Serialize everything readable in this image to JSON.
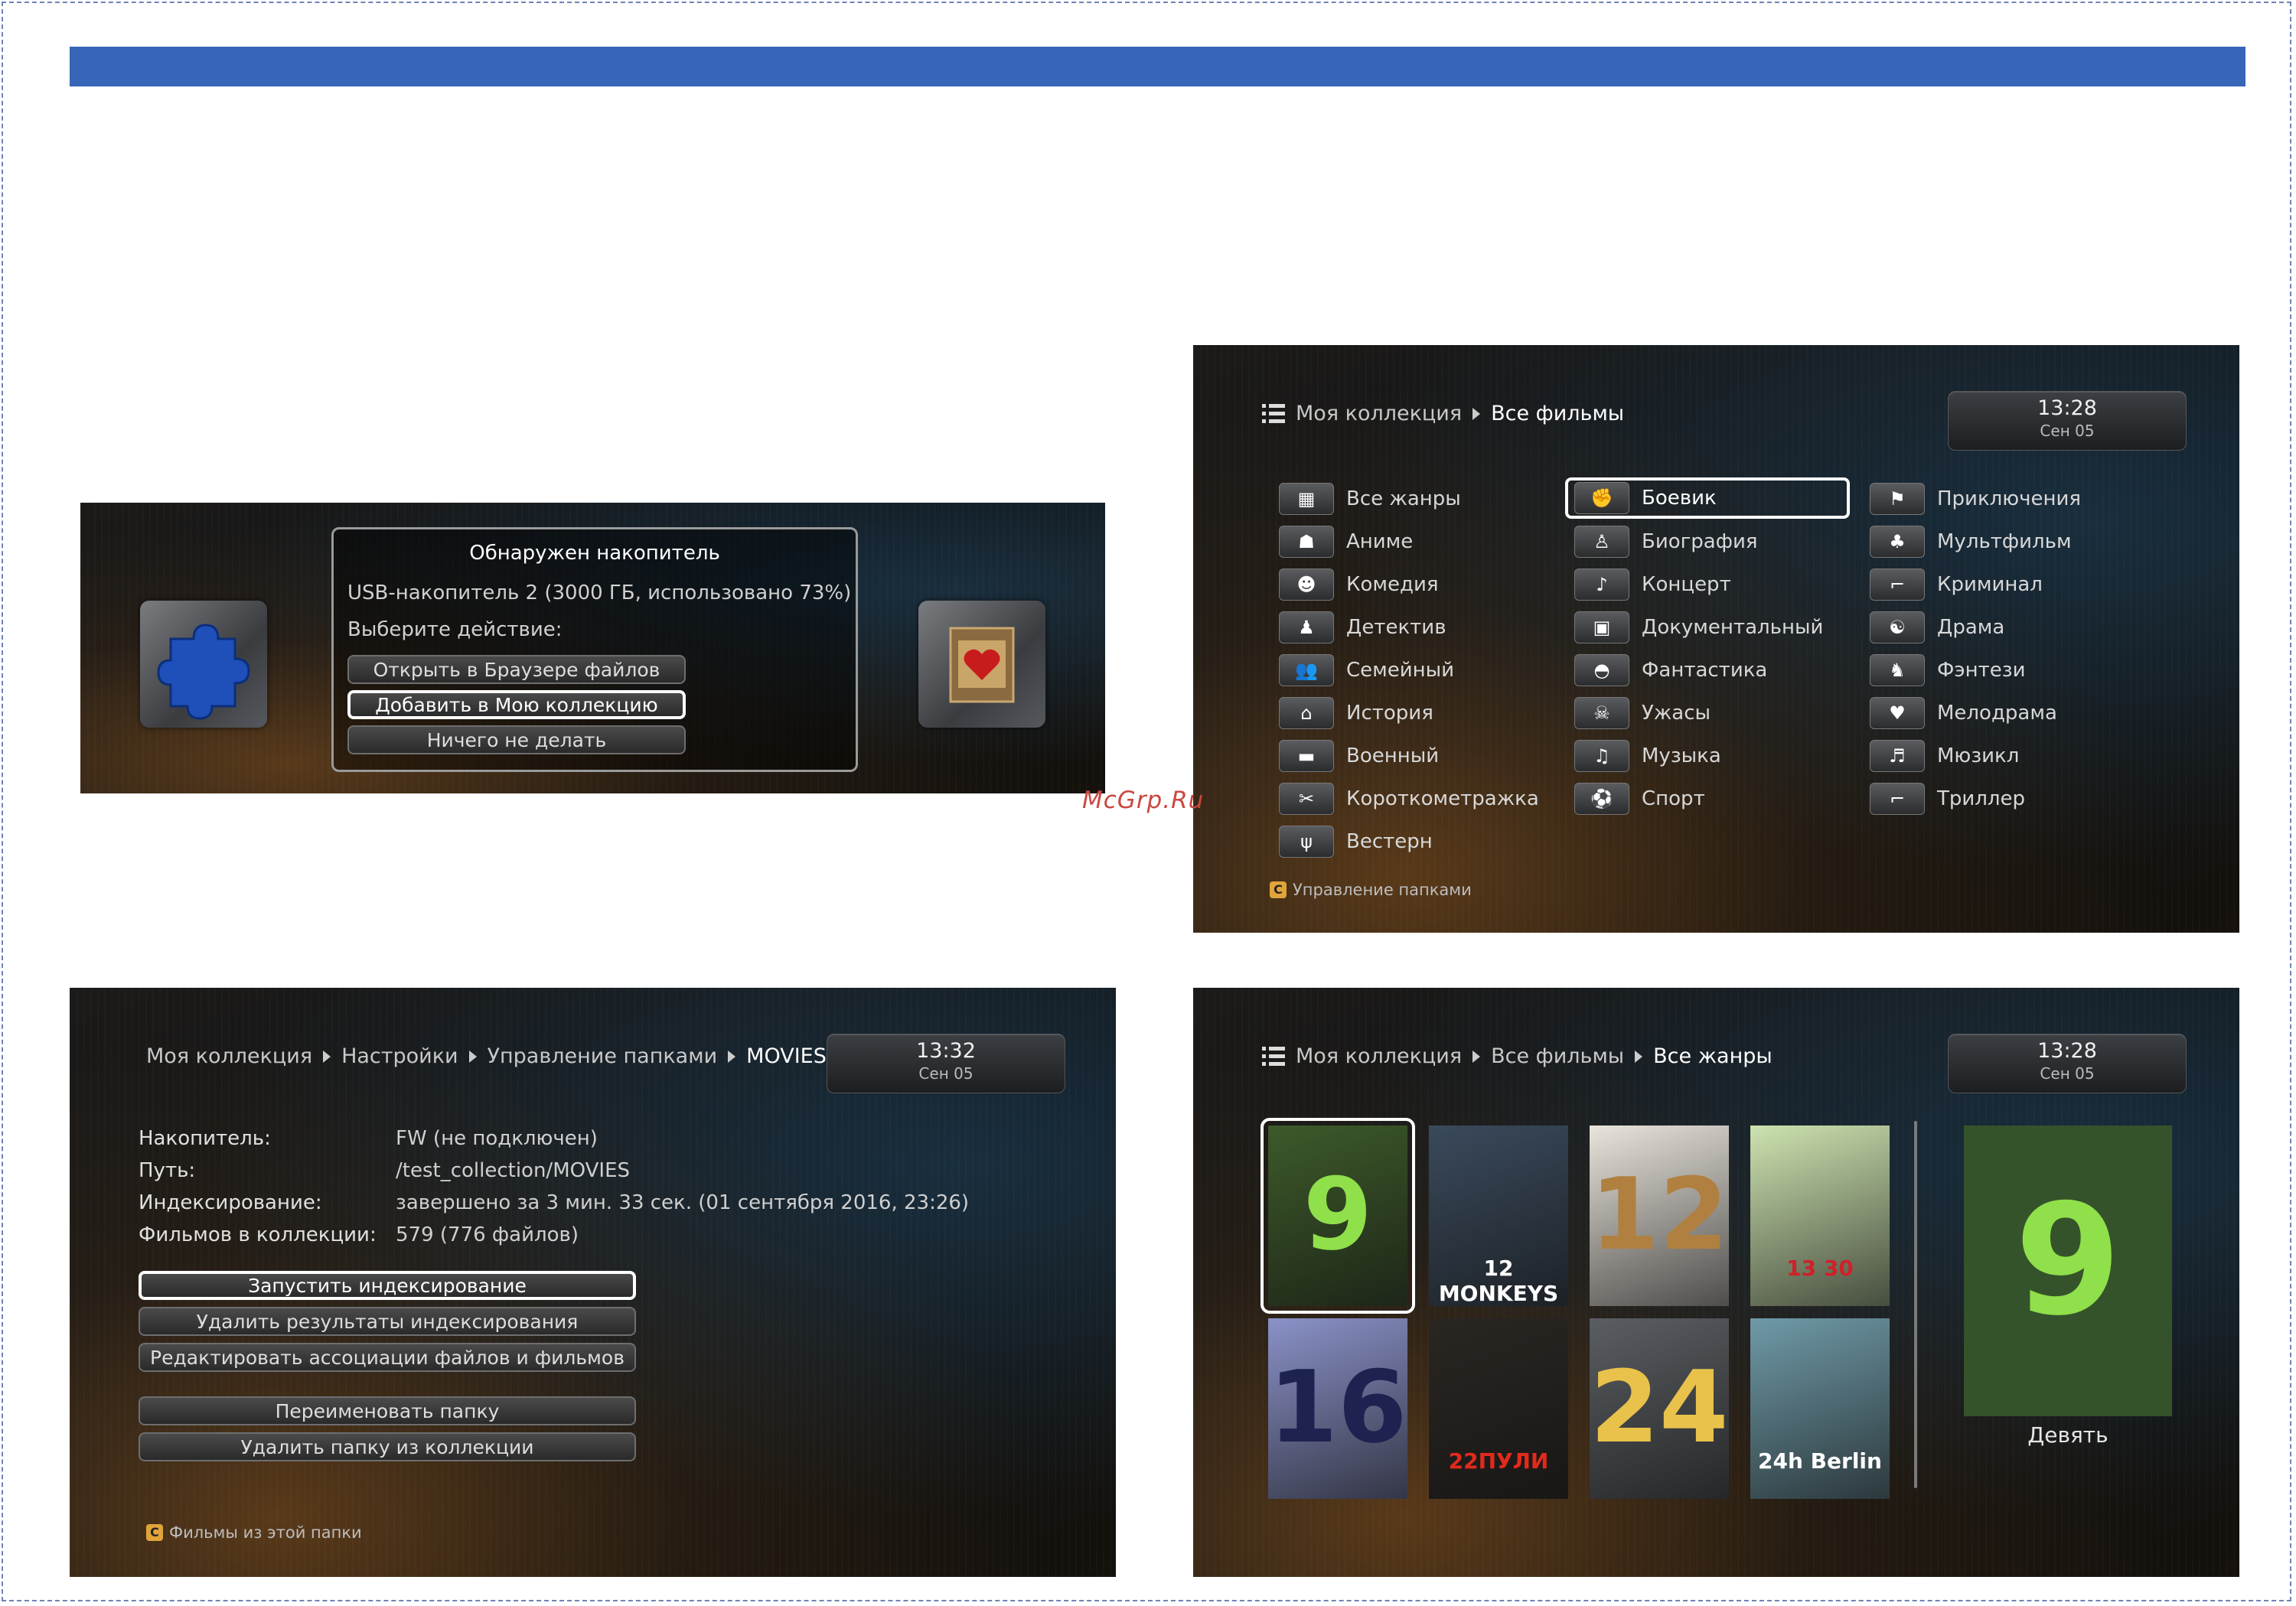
{
  "watermark": "McGrp.Ru",
  "s1": {
    "dialog_title": "Обнаружен накопитель",
    "device_line": "USB-накопитель 2 (3000 ГБ, использовано 73%)",
    "prompt": "Выберите действие:",
    "buttons": [
      "Открыть в Браузере файлов",
      "Добавить в Мою коллекцию",
      "Ничего не делать"
    ],
    "left_tile_icon": "puzzle-icon",
    "right_tile_icon": "film-heart-icon"
  },
  "s2": {
    "breadcrumb": [
      "Моя коллекция",
      "Все фильмы"
    ],
    "time": "13:28",
    "date": "Сен 05",
    "genres_col1": [
      {
        "label": "Все жанры",
        "icon": "grid-icon",
        "glyph": "▦"
      },
      {
        "label": "Аниме",
        "icon": "anime-icon",
        "glyph": "☗"
      },
      {
        "label": "Комедия",
        "icon": "smiley-icon",
        "glyph": "☻"
      },
      {
        "label": "Детектив",
        "icon": "detective-icon",
        "glyph": "♟"
      },
      {
        "label": "Семейный",
        "icon": "family-icon",
        "glyph": "👥"
      },
      {
        "label": "История",
        "icon": "columns-icon",
        "glyph": "⌂"
      },
      {
        "label": "Военный",
        "icon": "tank-icon",
        "glyph": "▬"
      },
      {
        "label": "Короткометражка",
        "icon": "short-icon",
        "glyph": "✂"
      },
      {
        "label": "Вестерн",
        "icon": "cactus-icon",
        "glyph": "ψ"
      }
    ],
    "genres_col2": [
      {
        "label": "Боевик",
        "icon": "fighter-icon",
        "glyph": "✊"
      },
      {
        "label": "Биография",
        "icon": "person-icon",
        "glyph": "♙"
      },
      {
        "label": "Концерт",
        "icon": "microphone-icon",
        "glyph": "♪"
      },
      {
        "label": "Документальный",
        "icon": "doc-icon",
        "glyph": "▣"
      },
      {
        "label": "Фантастика",
        "icon": "ufo-icon",
        "glyph": "◓"
      },
      {
        "label": "Ужасы",
        "icon": "scream-icon",
        "glyph": "☠"
      },
      {
        "label": "Музыка",
        "icon": "note-icon",
        "glyph": "♫"
      },
      {
        "label": "Спорт",
        "icon": "ball-icon",
        "glyph": "⚽"
      }
    ],
    "genres_col3": [
      {
        "label": "Приключения",
        "icon": "explorer-icon",
        "glyph": "⚑"
      },
      {
        "label": "Мультфильм",
        "icon": "cartoon-icon",
        "glyph": "♣"
      },
      {
        "label": "Криминал",
        "icon": "gun-icon",
        "glyph": "⌐"
      },
      {
        "label": "Драма",
        "icon": "masks-icon",
        "glyph": "☯"
      },
      {
        "label": "Фэнтези",
        "icon": "dragon-icon",
        "glyph": "♞"
      },
      {
        "label": "Мелодрама",
        "icon": "heart-icon",
        "glyph": "♥"
      },
      {
        "label": "Мюзикл",
        "icon": "tickets-icon",
        "glyph": "♬"
      },
      {
        "label": "Триллер",
        "icon": "pistol-icon",
        "glyph": "⌐"
      }
    ],
    "selected_genre": "Боевик",
    "footer_key": "C",
    "footer": "Управление папками"
  },
  "s3": {
    "breadcrumb": [
      "Моя коллекция",
      "Настройки",
      "Управление папками",
      "MOVIES"
    ],
    "time": "13:32",
    "date": "Сен 05",
    "info": [
      {
        "k": "Накопитель:",
        "v": "FW (не подключен)"
      },
      {
        "k": "Путь:",
        "v": "/test_collection/MOVIES"
      },
      {
        "k": "Индексирование:",
        "v": "завершено за 3 мин. 33 сек. (01 сентября 2016, 23:26)"
      },
      {
        "k": "Фильмов в коллекции:",
        "v": "579 (776 файлов)"
      }
    ],
    "buttons": [
      "Запустить индексирование",
      "Удалить результаты индексирования",
      "Редактировать ассоциации файлов и фильмов",
      "Переименовать папку",
      "Удалить папку из коллекции"
    ],
    "footer_key": "C",
    "footer": "Фильмы из этой папки"
  },
  "s4": {
    "breadcrumb": [
      "Моя коллекция",
      "Все фильмы",
      "Все жанры"
    ],
    "time": "13:28",
    "date": "Сен 05",
    "posters": [
      {
        "text": "9",
        "bg": "#3d5a2a",
        "fg": "#8fe04a"
      },
      {
        "text": "12 MONKEYS",
        "bg": "#3a4a5c",
        "fg": "#ffffff"
      },
      {
        "text": "12",
        "bg": "#e9e4dc",
        "fg": "#b08040"
      },
      {
        "text": "13 30",
        "bg": "#cde3b0",
        "fg": "#d0202a"
      },
      {
        "text": "16",
        "bg": "#8a92c8",
        "fg": "#1d2250"
      },
      {
        "text": "22ПУЛИ",
        "bg": "#2a2622",
        "fg": "#e22a1c"
      },
      {
        "text": "24",
        "bg": "#5a5e62",
        "fg": "#e8c24a"
      },
      {
        "text": "24h Berlin",
        "bg": "#6f9aa8",
        "fg": "#ffffff"
      }
    ],
    "preview_title": "Девять",
    "preview_text": "9"
  }
}
